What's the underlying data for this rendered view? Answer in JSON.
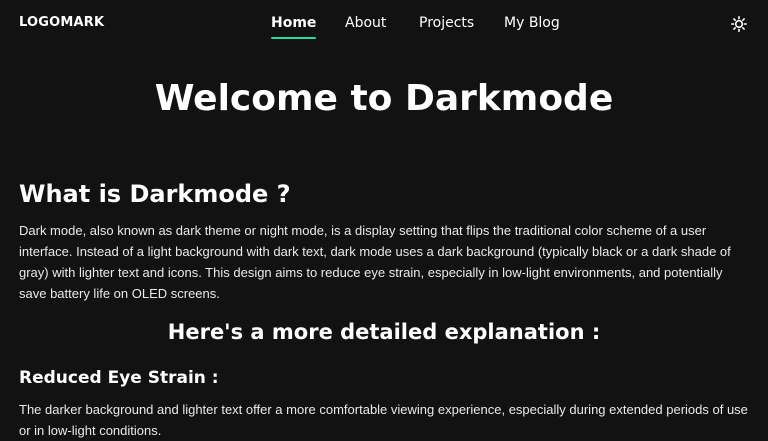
{
  "nav": {
    "logo": "LOGOMARK",
    "links": [
      {
        "label": "Home",
        "active": true
      },
      {
        "label": "About",
        "active": false
      },
      {
        "label": "Projects",
        "active": false
      },
      {
        "label": "My Blog",
        "active": false
      }
    ],
    "theme_toggle_icon": "sun-icon",
    "accent_color": "#2bd9a5"
  },
  "main": {
    "title": "Welcome to Darkmode",
    "section_title": "What is Darkmode ?",
    "section_paragraph": "Dark mode, also known as dark theme or night mode, is a display setting that flips the traditional color scheme of a user interface. Instead of a light background with dark text, dark mode uses a dark background (typically black or a dark shade of gray) with lighter text and icons. This design aims to reduce eye strain, especially in low-light environments, and potentially save battery life on OLED screens.",
    "detail_title": "Here's a more detailed explanation :",
    "point_title": "Reduced Eye Strain :",
    "point_paragraph": "The darker background and lighter text offer a more comfortable viewing experience, especially during extended periods of use or in low-light conditions."
  },
  "colors": {
    "background": "#121212",
    "text": "#ffffff"
  }
}
